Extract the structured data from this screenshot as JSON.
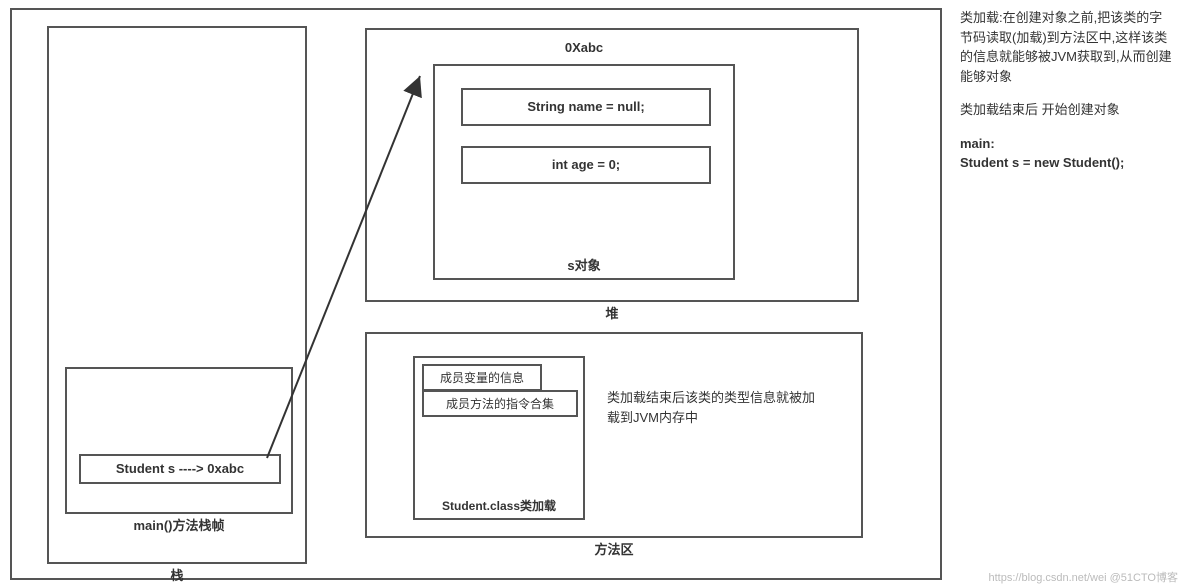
{
  "stack": {
    "var_text": "Student s ----> 0xabc",
    "frame_label": "main()方法栈帧",
    "area_label": "栈"
  },
  "heap": {
    "addr": "0Xabc",
    "field1": "String name = null;",
    "field2": "int age = 0;",
    "obj_label": "s对象",
    "area_label": "堆"
  },
  "method_area": {
    "m1": "成员变量的信息",
    "m2": "成员方法的指令合集",
    "class_label": "Student.class类加载",
    "note": "类加载结束后该类的类型信息就被加载到JVM内存中",
    "area_label": "方法区"
  },
  "side": {
    "p1": "类加载:在创建对象之前,把该类的字节码读取(加载)到方法区中,这样该类的信息就能够被JVM获取到,从而创建能够对象",
    "p2": "类加载结束后 开始创建对象",
    "p3a": "main:",
    "p3b": "Student s = new Student();"
  },
  "watermark": "https://blog.csdn.net/wei @51CTO博客"
}
